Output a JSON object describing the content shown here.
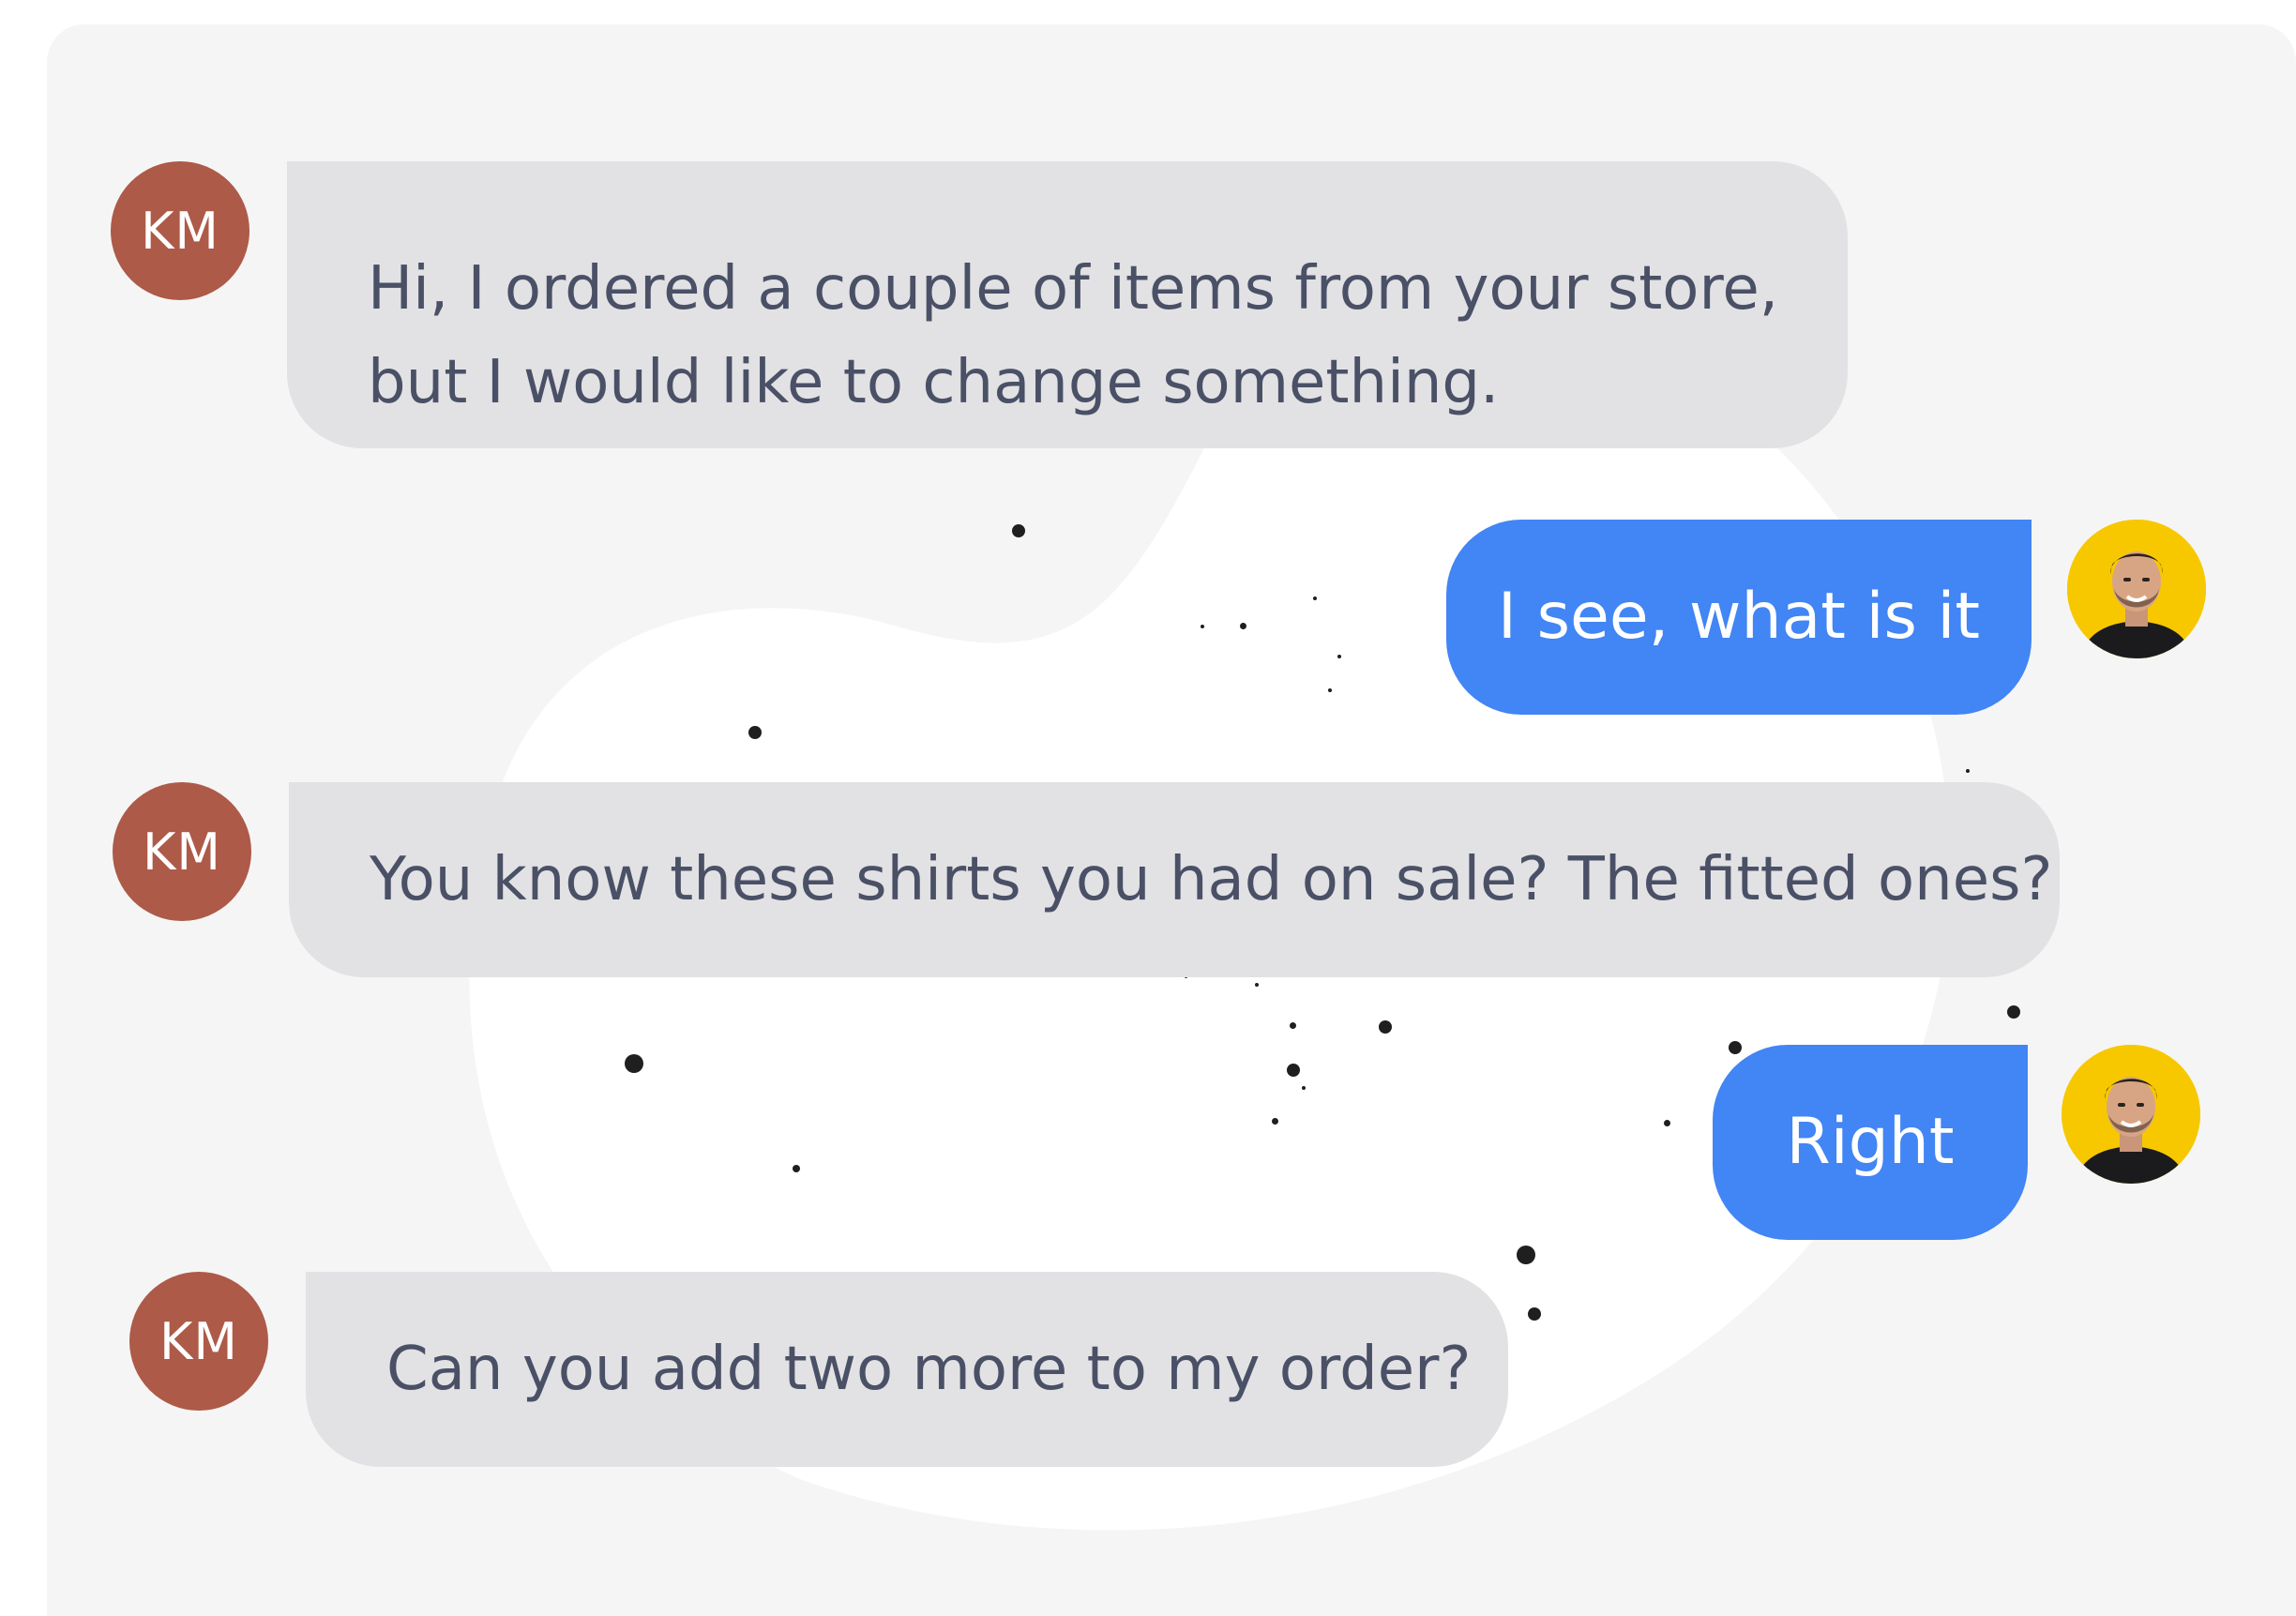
{
  "messages": [
    {
      "sender": "customer",
      "avatar_initials": "KM",
      "text_lines": [
        "Hi, I ordered a couple of items from your store,",
        "but I would like to change something."
      ]
    },
    {
      "sender": "agent",
      "avatar_icon": "agent-avatar-photo",
      "text": "I see, what is it"
    },
    {
      "sender": "customer",
      "avatar_initials": "KM",
      "text": "You know these shirts you had on sale? The fitted ones?"
    },
    {
      "sender": "agent",
      "avatar_icon": "agent-avatar-photo",
      "text": "Right"
    },
    {
      "sender": "customer",
      "avatar_initials": "KM",
      "text": "Can you add two more to my order?"
    }
  ],
  "colors": {
    "customer_avatar": "#ad5a48",
    "customer_bubble": "#e2e2e4",
    "agent_bubble": "#4285f4",
    "agent_avatar_bg": "#f7c800",
    "panel_bg": "#f5f5f5"
  }
}
